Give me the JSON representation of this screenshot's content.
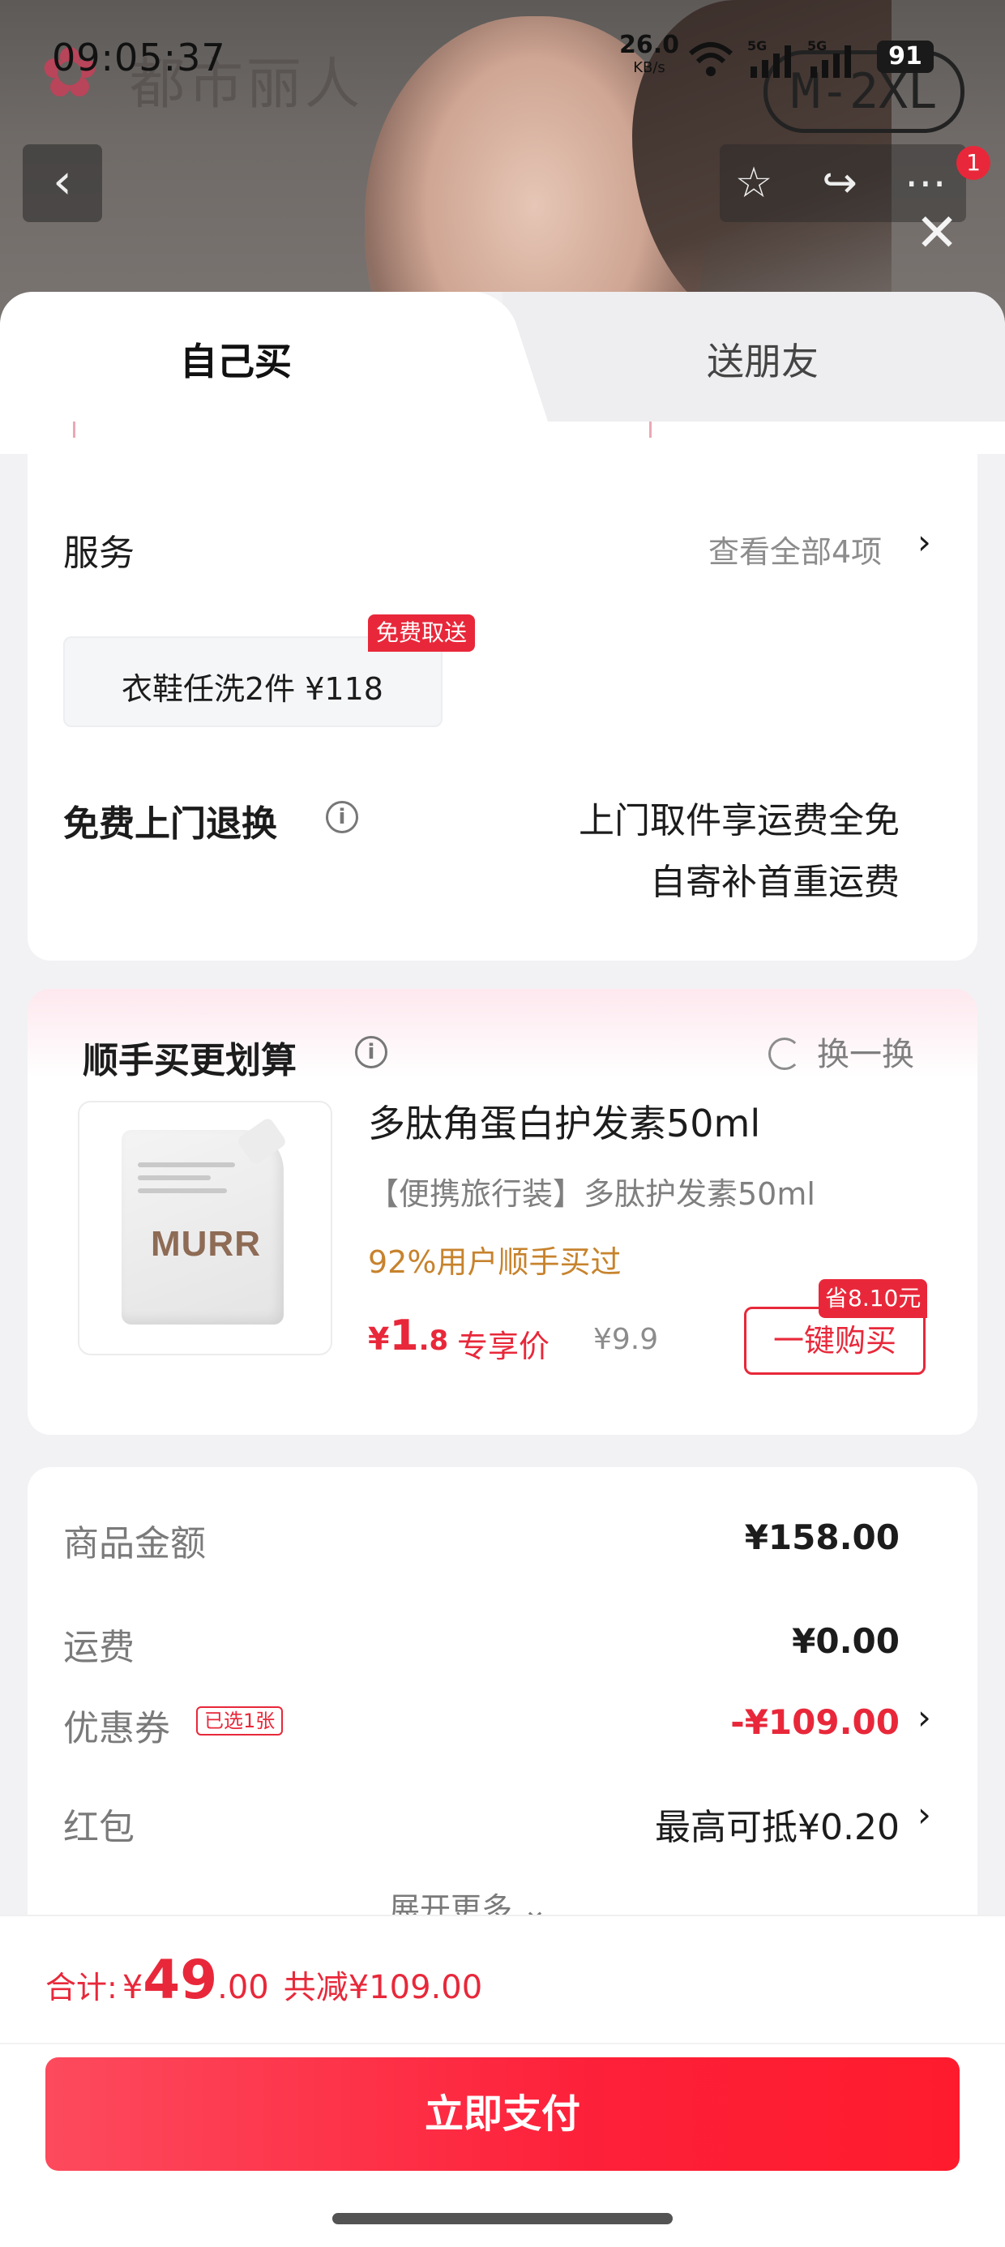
{
  "status_bar": {
    "time": "09:05:37",
    "net_speed": "26.0",
    "net_unit": "KB/s",
    "sig1_label": "5G",
    "sig2_label": "5G",
    "battery": "91"
  },
  "header": {
    "brand_name": "都市丽人",
    "size_badge": "M-2XL",
    "cart_count": "1",
    "icons": [
      "back-icon",
      "star-icon",
      "share-icon",
      "more-icon",
      "close-icon"
    ]
  },
  "tabs": [
    {
      "label": "自己买"
    },
    {
      "label": "送朋友"
    }
  ],
  "services": {
    "title": "服务",
    "view_all": "查看全部4项",
    "item_text": "衣鞋任洗2件  ¥118",
    "item_badge": "免费取送",
    "return_title": "免费上门退换",
    "return_line1": "上门取件享运费全免",
    "return_line2": "自寄补首重运费"
  },
  "addon": {
    "title": "顺手买更划算",
    "swap_label": "换一换",
    "product_name": "多肽角蛋白护发素50ml",
    "product_sub": "【便携旅行装】多肽护发素50ml",
    "stat": "92%用户顺手买过",
    "price_currency": "¥",
    "price_int": "1",
    "price_dec": ".8",
    "price_tag": "专享价",
    "price_old": "¥9.9",
    "buy_label": "一键购买",
    "save_badge": "省8.10元",
    "pouch_logo": "MURR"
  },
  "summary": {
    "rows": [
      {
        "label": "商品金额",
        "value": "¥158.00"
      },
      {
        "label": "运费",
        "value": "¥0.00"
      },
      {
        "label": "优惠券",
        "value": "-¥109.00",
        "badge": "已选1张"
      },
      {
        "label": "红包",
        "value": "最高可抵¥0.20"
      }
    ],
    "expand_more": "展开更多"
  },
  "bottom": {
    "total_label": "合计:",
    "total_currency": "¥",
    "total_int": "49",
    "total_dec": ".00",
    "total_saved": "共减¥109.00",
    "pay_label": "立即支付"
  },
  "colors": {
    "accent": "#e8283a",
    "gold": "#c7832d",
    "pay_gradient_start": "#fd4a5d",
    "pay_gradient_end": "#fe1b2d"
  }
}
